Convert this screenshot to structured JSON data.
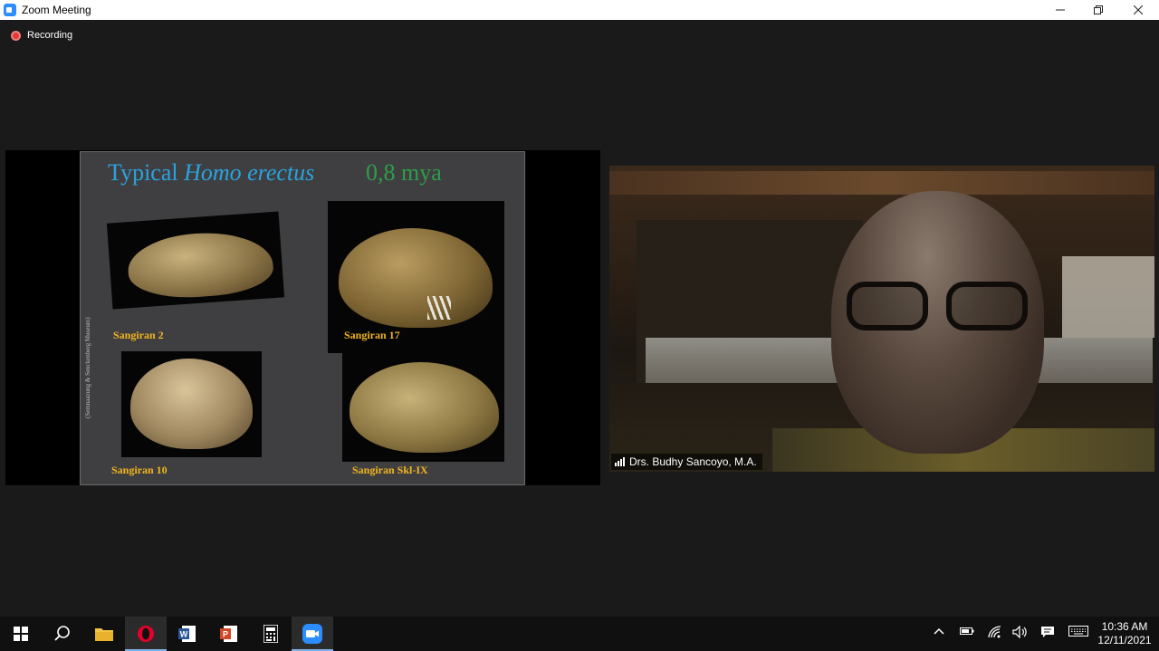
{
  "window": {
    "title": "Zoom Meeting"
  },
  "recording": {
    "label": "Recording"
  },
  "slide": {
    "title_prefix": "Typical ",
    "title_italic": "Homo erectus",
    "title_suffix": "0,8 mya",
    "credit": "(Semnaazung & Senckenberg Museum)",
    "captions": [
      "Sangiran 2",
      "Sangiran 17",
      "Sangiran 10",
      "Sangiran Skl-IX"
    ]
  },
  "participant": {
    "name": "Drs. Budhy Sancoyo, M.A."
  },
  "taskbar": {
    "apps": [
      "windows-start",
      "search",
      "file-explorer",
      "opera",
      "word",
      "powerpoint",
      "calculator",
      "zoom"
    ],
    "time": "10:36 AM",
    "date": "12/11/2021"
  },
  "colors": {
    "slide_title": "#2aa3e0",
    "slide_mya": "#2e9e4a",
    "caption": "#f2b51f",
    "recording_dot": "#e53935",
    "zoom_blue": "#2d8cff"
  }
}
